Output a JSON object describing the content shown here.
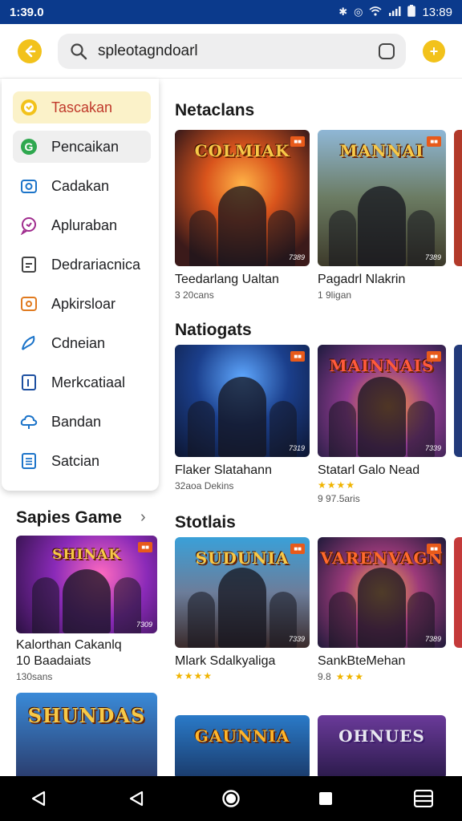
{
  "status_bar": {
    "time_left": "1:39.0",
    "time_right": "13:89",
    "icons": [
      "bluetooth-icon",
      "alarm-icon",
      "wifi-icon",
      "signal-icon",
      "battery-icon"
    ]
  },
  "search": {
    "value": "spleotagndoarl"
  },
  "drawer": {
    "items": [
      {
        "label": "Tascakan",
        "icon": "clock-icon"
      },
      {
        "label": "Pencaikan",
        "icon": "google-g-icon"
      },
      {
        "label": "Cadakan",
        "icon": "camera-icon"
      },
      {
        "label": "Apluraban",
        "icon": "chat-icon"
      },
      {
        "label": "Dedrariacnica",
        "icon": "document-icon"
      },
      {
        "label": "Apkirsloar",
        "icon": "box-icon"
      },
      {
        "label": "Cdneian",
        "icon": "feather-icon"
      },
      {
        "label": "Merkcatiaal",
        "icon": "bookmark-icon"
      },
      {
        "label": "Bandan",
        "icon": "cloud-icon"
      },
      {
        "label": "Satcian",
        "icon": "list-icon"
      }
    ]
  },
  "sections": {
    "netaclans": {
      "title": "Netaclans"
    },
    "natiogats": {
      "title": "Natiogats"
    },
    "stotlais": {
      "title": "Stotlais"
    },
    "sapies": {
      "title": "Sapies Game"
    }
  },
  "cards": {
    "c1": {
      "art_title": "COLMIAK",
      "name": "Teedarlang Ualtan",
      "sub": "3 20cans",
      "tag": "7389"
    },
    "c2": {
      "art_title": "MANNAI",
      "name": "Pagadrl Nlakrin",
      "sub": "1 9ligan",
      "tag": "7389"
    },
    "c3": {
      "art_title": "",
      "name": "Flaker Slatahann",
      "sub": "32aoa Dekins",
      "tag": "7319"
    },
    "c4": {
      "art_title": "MAINNAIS",
      "name": "Statarl Galo Nead",
      "sub": "9 97.5aris",
      "tag": "7339"
    },
    "c5": {
      "art_title": "SUDUNIA",
      "name": "Mlark Sdalkyaliga",
      "sub": "",
      "tag": "7339"
    },
    "c6": {
      "art_title": "VARENVAGN",
      "name": "SankBteMehan",
      "sub": "9.8",
      "tag": "7389"
    },
    "c7": {
      "art_title": "GAUNNIA",
      "name": "",
      "sub": "",
      "tag": ""
    },
    "c8": {
      "art_title": "OHNUES",
      "name": "",
      "sub": "",
      "tag": ""
    },
    "s1": {
      "art_title": "SHINAK",
      "name": "Kalorthan Cakanlq",
      "name2": "10 Baadaiats",
      "sub": "130sans",
      "tag": "7309"
    },
    "s2": {
      "art_title": "SHUNDAS",
      "name": "",
      "sub": "",
      "tag": ""
    }
  },
  "ratings": {
    "c4": 4,
    "c5": 4,
    "c6": 3
  },
  "colors": {
    "status_bar": "#0b3a8c",
    "accent_yellow": "#f2c21b",
    "active_menu_bg": "#fbf2c9"
  }
}
